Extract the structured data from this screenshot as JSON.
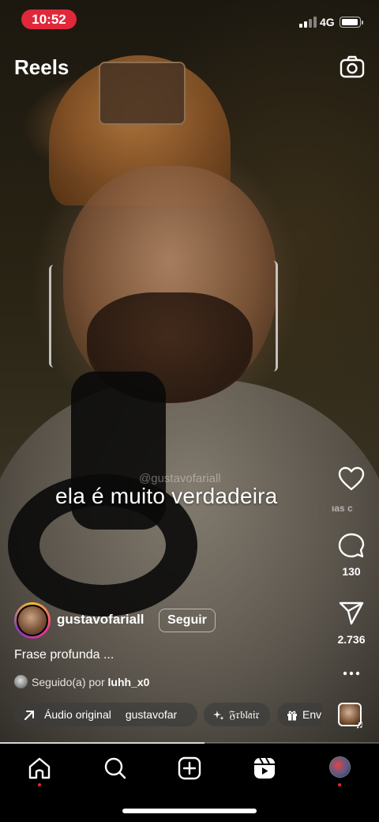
{
  "status_bar": {
    "time": "10:52",
    "network": "4G",
    "time_pill_color": "#e0283a"
  },
  "header": {
    "title": "Reels",
    "camera_icon": "camera-icon"
  },
  "video": {
    "watermark": "@gustavofariall",
    "overlay_caption": "ela é muito verdadeira",
    "faded_text": "ıas   c"
  },
  "actions": {
    "like": {
      "icon": "heart-icon",
      "count": ""
    },
    "comment": {
      "icon": "comment-icon",
      "count": "130"
    },
    "share": {
      "icon": "send-icon",
      "count": "2.736"
    },
    "more": {
      "icon": "more-horizontal-icon"
    }
  },
  "post": {
    "username": "gustavofariall",
    "follow_label": "Seguir",
    "caption": "Frase profunda ...",
    "followed_prefix": "Seguido(a) por ",
    "followed_by": "luhh_x0"
  },
  "chips": [
    {
      "icon": "arrow-up-right-icon",
      "label": "Áudio original",
      "extra": "gustavofar"
    },
    {
      "icon": "sparkle-icon",
      "label": "𝔉𝔯𝔟𝔩𝔞𝔦𝔯"
    },
    {
      "icon": "gift-icon",
      "label": "Env"
    }
  ],
  "progress": {
    "value": 0.54
  },
  "bottom_nav": {
    "items": [
      "home-icon",
      "search-icon",
      "create-icon",
      "reels-icon",
      "profile-avatar"
    ]
  }
}
